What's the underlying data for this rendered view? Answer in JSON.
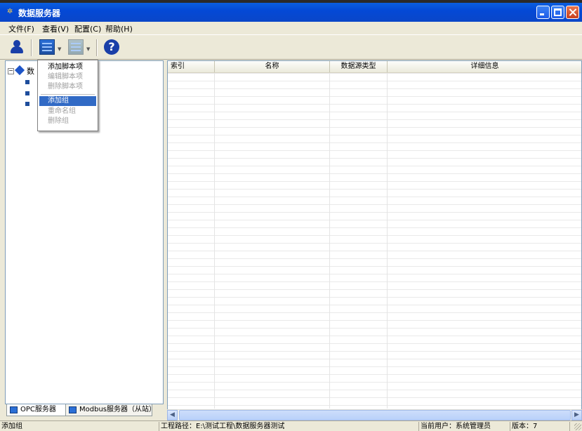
{
  "window": {
    "title": "数据服务器"
  },
  "menubar": {
    "items": [
      "文件(F)",
      "查看(V)",
      "配置(C)",
      "帮助(H)"
    ]
  },
  "context_menu": {
    "items": [
      {
        "label": "添加脚本项",
        "enabled": true
      },
      {
        "label": "编辑脚本项",
        "enabled": false
      },
      {
        "label": "删除脚本项",
        "enabled": false
      },
      {
        "label": "添加组",
        "enabled": true,
        "selected": true
      },
      {
        "label": "重命名组",
        "enabled": false
      },
      {
        "label": "删除组",
        "enabled": false
      }
    ]
  },
  "tree": {
    "root_partial_label": "数"
  },
  "tabs": [
    {
      "label": "OPC服务器"
    },
    {
      "label": "Modbus服务器（从站）"
    }
  ],
  "grid": {
    "columns": [
      "索引",
      "名称",
      "数据源类型",
      "详细信息"
    ]
  },
  "statusbar": {
    "hint": "添加组",
    "path": "工程路径：E:\\测试工程\\数据服务器测试",
    "user": "当前用户：系统管理员",
    "version": "版本：7"
  },
  "colors": {
    "titlebar": "#0449d6",
    "selection": "#316ac5",
    "window_bg": "#ece9d8"
  }
}
